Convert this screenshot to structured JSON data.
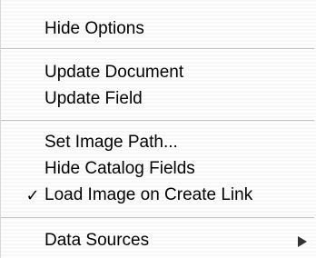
{
  "menu": {
    "items": [
      {
        "label": "Hide Options"
      },
      {
        "label": "Update Document"
      },
      {
        "label": "Update Field"
      },
      {
        "label": "Set Image Path..."
      },
      {
        "label": "Hide Catalog Fields"
      },
      {
        "label": "Load Image on Create Link",
        "checked": true,
        "check_glyph": "✓"
      },
      {
        "label": "Data Sources",
        "has_submenu": true
      }
    ]
  }
}
